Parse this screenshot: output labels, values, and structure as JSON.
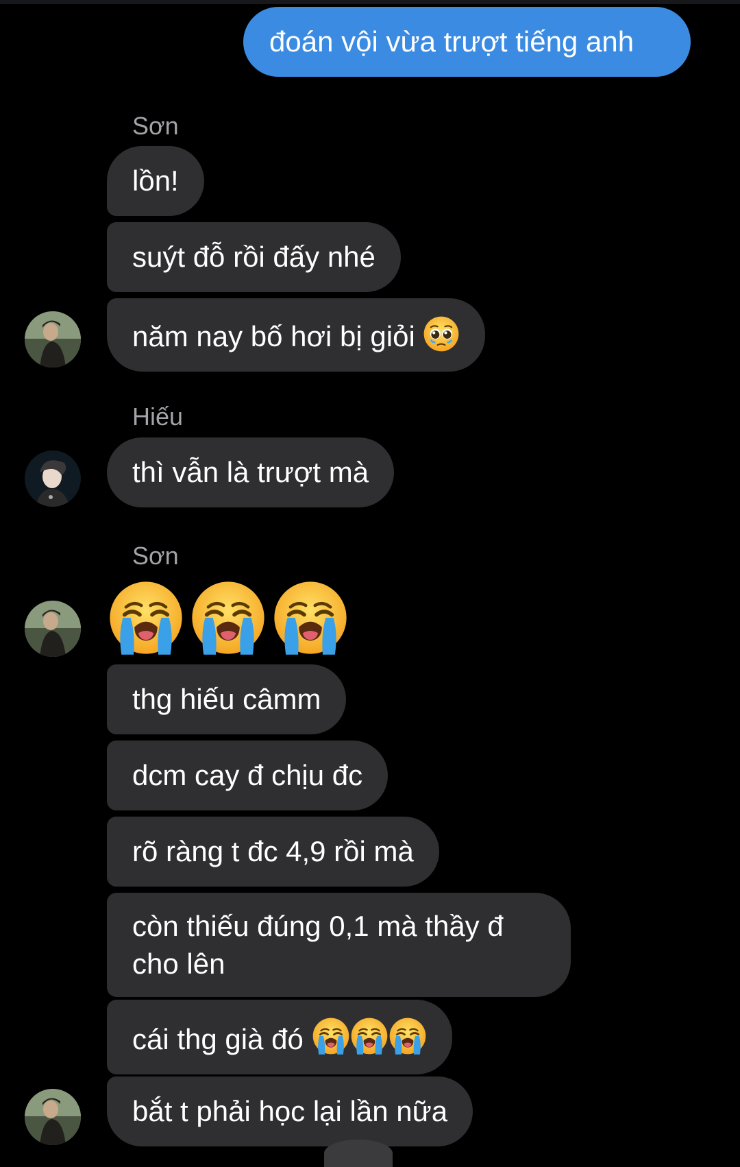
{
  "messages": {
    "outgoing_1": "đoán vội vừa trượt tiếng anh",
    "son_1": "lồn!",
    "son_2": "suýt đỗ rồi đấy nhé",
    "son_3": "năm nay bố hơi bị giỏi",
    "hieu_1": "thì vẫn là trượt mà",
    "son_5": "thg hiếu câmm",
    "son_6": "dcm cay đ chịu đc",
    "son_7": "rõ ràng t đc 4,9 rồi mà",
    "son_8": "còn thiếu đúng 0,1 mà thầy đ cho lên",
    "son_9": "cái thg già đó",
    "son_10": "bắt t phải học lại lần nữa"
  },
  "senders": {
    "son": "Sơn",
    "hieu": "Hiếu"
  },
  "emoji": {
    "son_3_emoji": "pleading-face",
    "son_4_big": [
      "loudly-crying-face",
      "loudly-crying-face",
      "loudly-crying-face"
    ],
    "son_9_emoji": [
      "loudly-crying-face",
      "loudly-crying-face",
      "loudly-crying-face"
    ]
  },
  "colors": {
    "background": "#000000",
    "outgoing_bubble": "#3b8be3",
    "incoming_bubble": "#2f2f31",
    "sender_name": "#a3a3a8"
  }
}
